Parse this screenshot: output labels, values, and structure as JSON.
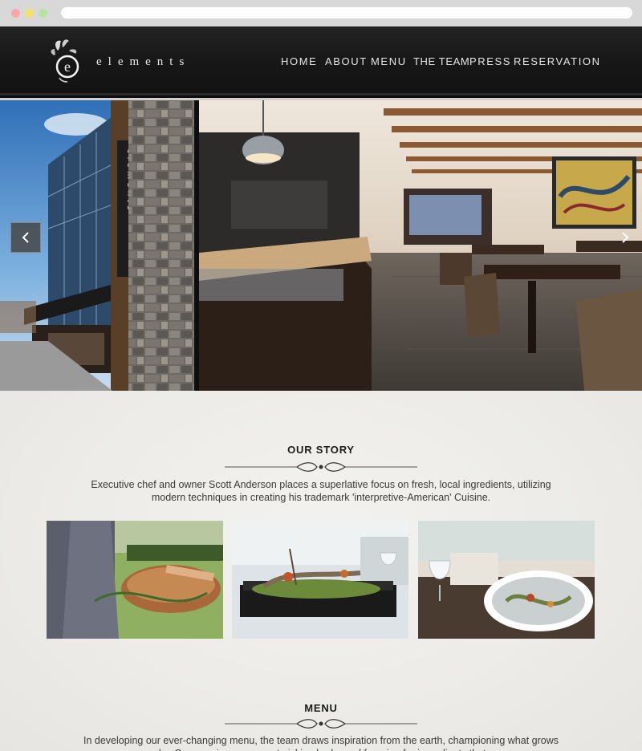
{
  "brand": {
    "name": "elements"
  },
  "nav": {
    "items": [
      {
        "label": "HOME"
      },
      {
        "label": "ABOUT"
      },
      {
        "label": "MENU"
      },
      {
        "label": "THE TEAM"
      },
      {
        "label": "PRESS"
      },
      {
        "label": "RESERVATION"
      }
    ]
  },
  "hero": {
    "sign_text": "elements",
    "prev_icon": "chevron-left-icon",
    "next_icon": "chevron-right-icon"
  },
  "story": {
    "title": "OUR STORY",
    "text": "Executive chef and owner Scott Anderson places a superlative focus on fresh, local ingredients, utilizing modern techniques in creating his trademark 'interpretive-American' Cuisine."
  },
  "menu_section": {
    "title": "MENU",
    "text": "In developing our ever-changing menu, the team draws inspiration from the earth, championing what grows nearby. Our mornings are spent picking herbs and foraging for ingredients that are"
  },
  "colors": {
    "header_bg": "#1a1a1a",
    "page_bg": "#eeede9",
    "nav_text": "#e6e6e6",
    "body_text": "#3a3a3a"
  }
}
